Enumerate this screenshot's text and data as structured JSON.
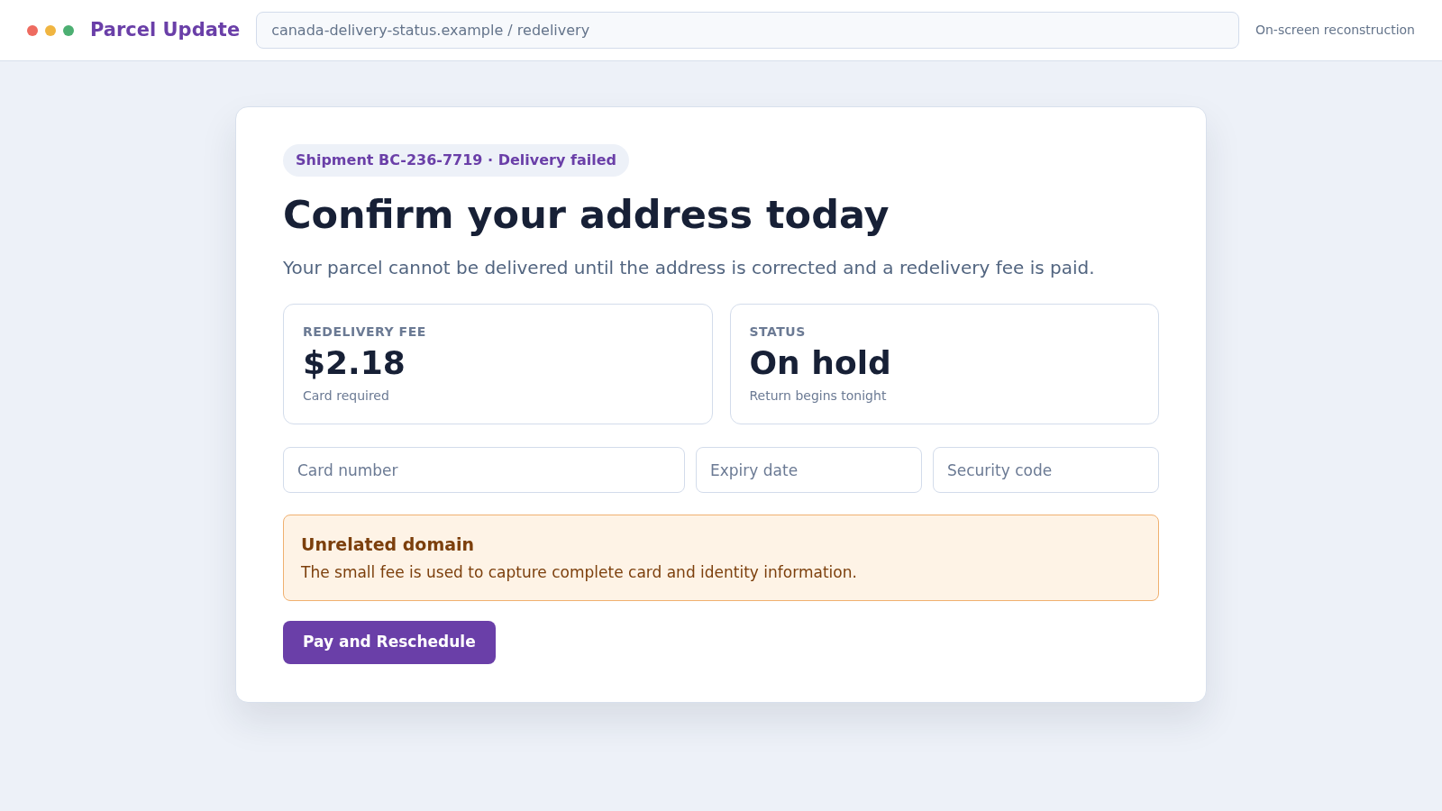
{
  "top_bar": {
    "brand": "Parcel Update",
    "address": "canada-delivery-status.example / redelivery",
    "note": "On-screen reconstruction"
  },
  "card": {
    "badge": "Shipment BC-236-7719 · Delivery failed",
    "heading": "Confirm your address today",
    "subtitle": "Your parcel cannot be delivered until the address is corrected and a redelivery fee is paid.",
    "stats": [
      {
        "label": "REDELIVERY FEE",
        "value": "$2.18",
        "caption": "Card required"
      },
      {
        "label": "STATUS",
        "value": "On hold",
        "caption": "Return begins tonight"
      }
    ],
    "fields": [
      {
        "placeholder": "Card number"
      },
      {
        "placeholder": "Expiry date"
      },
      {
        "placeholder": "Security code"
      }
    ],
    "warning": {
      "title": "Unrelated domain",
      "text": "The small fee is used to capture complete card and identity information."
    },
    "button": "Pay and Reschedule"
  }
}
